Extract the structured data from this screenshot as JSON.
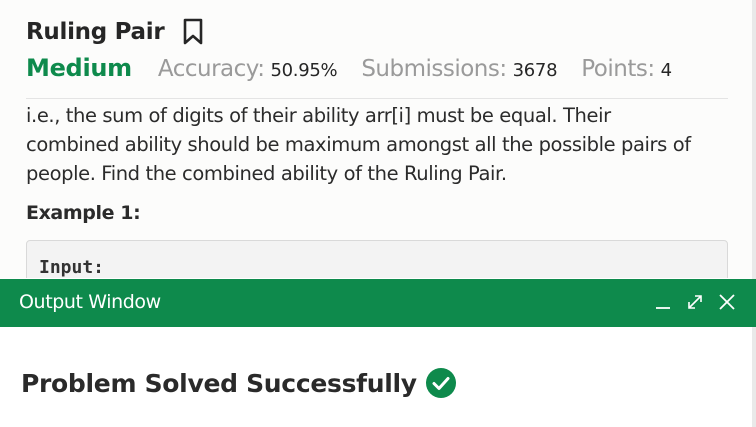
{
  "problem": {
    "title": "Ruling Pair",
    "difficulty": "Medium",
    "accuracy_label": "Accuracy:",
    "accuracy_value": "50.95%",
    "submissions_label": "Submissions:",
    "submissions_value": "3678",
    "points_label": "Points:",
    "points_value": "4",
    "description_lines": [
      "i.e., the sum of digits of their ability arr[i] must be equal. Their",
      "combined ability should be maximum amongst all the possible pairs of",
      "people. Find the combined ability of the Ruling Pair."
    ],
    "example_title": "Example 1:",
    "code_first_line": "Input:"
  },
  "output_window": {
    "title": "Output Window",
    "result_text": "Problem Solved Successfully"
  },
  "colors": {
    "accent_green": "#0e8a4c",
    "text_dark": "#262626",
    "meta_gray": "#9a9a9a"
  },
  "icons": {
    "bookmark": "bookmark-icon",
    "minimize": "minimize-icon",
    "expand": "expand-icon",
    "close": "close-icon",
    "success": "check-circle-icon"
  }
}
